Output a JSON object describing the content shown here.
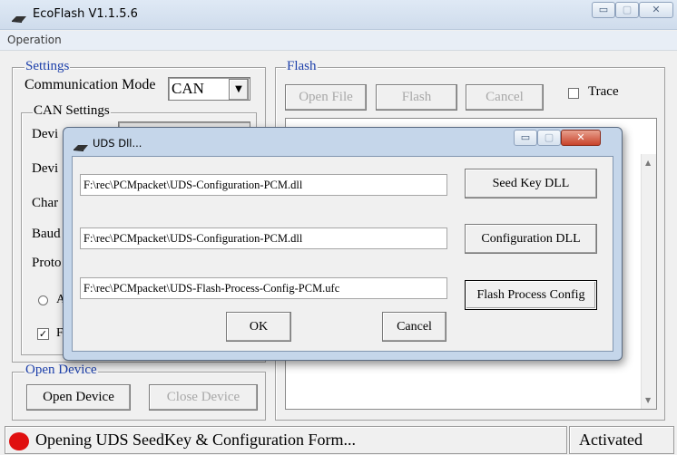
{
  "window": {
    "title": "EcoFlash V1.1.5.6",
    "menu": [
      "Operation"
    ],
    "controls": [
      "▭",
      "▢",
      "✕"
    ]
  },
  "settings": {
    "legend": "Settings",
    "comm_mode_label": "Communication Mode",
    "comm_mode_value": "CAN",
    "can_legend": "CAN Settings",
    "row_labels_clipped": [
      "Devi",
      "Devi",
      "Char",
      "Baud",
      "Proto"
    ],
    "radio_clipped": "A",
    "checkbox_clipped": "F"
  },
  "flash": {
    "legend": "Flash",
    "open_file": "Open File",
    "flash_btn": "Flash",
    "cancel": "Cancel",
    "trace_label": "Trace"
  },
  "open_device": {
    "legend": "Open Device",
    "open": "Open Device",
    "close": "Close Device"
  },
  "dialog": {
    "title": "UDS Dll...",
    "rows": [
      {
        "path": "F:\\rec\\PCMpacket\\UDS-Configuration-PCM.dll",
        "button": "Seed Key DLL"
      },
      {
        "path": "F:\\rec\\PCMpacket\\UDS-Configuration-PCM.dll",
        "button": "Configuration DLL"
      },
      {
        "path": "F:\\rec\\PCMpacket\\UDS-Flash-Process-Config-PCM.ufc",
        "button": "Flash Process Config"
      }
    ],
    "ok": "OK",
    "cancel": "Cancel"
  },
  "status": {
    "message": "Opening UDS SeedKey & Configuration Form...",
    "state": "Activated",
    "indicator_color": "#e01010"
  }
}
